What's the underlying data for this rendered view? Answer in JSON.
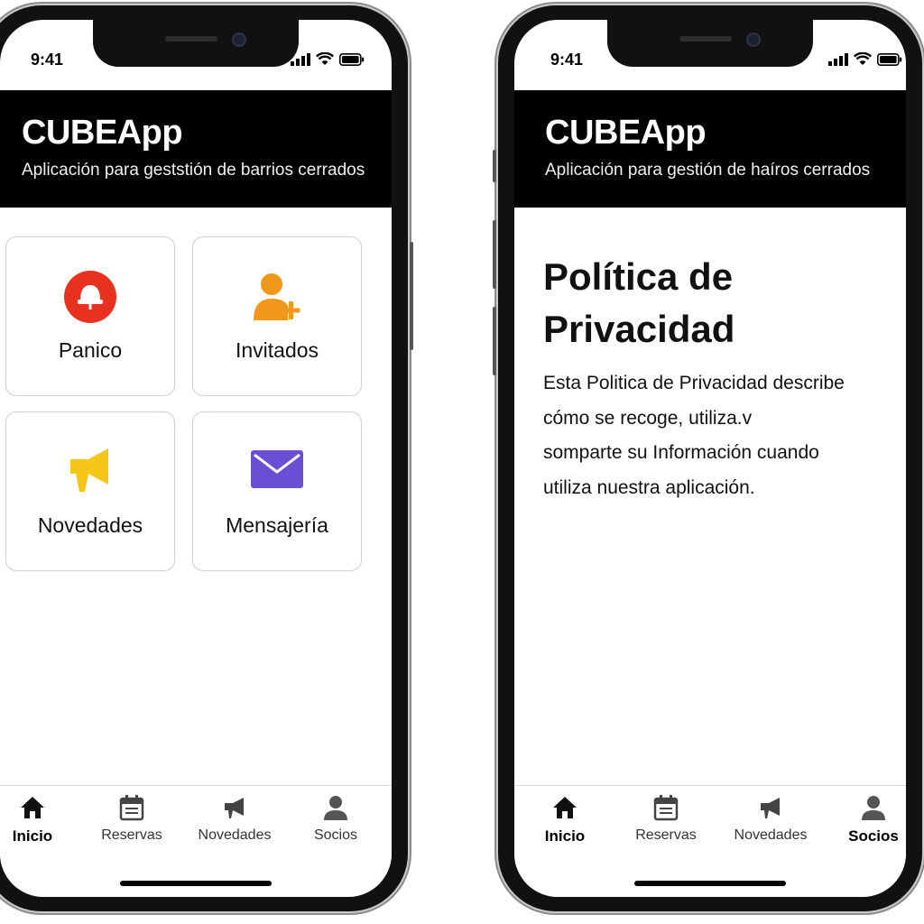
{
  "colors": {
    "header_bg": "#000000",
    "panic": "#e8311f",
    "guests": "#f0981a",
    "news": "#f5c518",
    "messages": "#6a4fd4",
    "tab_icon": "#444444"
  },
  "left_phone": {
    "status": {
      "time": "9:41"
    },
    "header": {
      "title": "CUBEApp",
      "subtitle": "Aplicación para geststión de barrios cerrados"
    },
    "cards": [
      {
        "label": "Panico",
        "icon": "panic-alarm-icon"
      },
      {
        "label": "Invitados",
        "icon": "add-guest-icon"
      },
      {
        "label": "Novedades",
        "icon": "megaphone-icon"
      },
      {
        "label": "Mensajería",
        "icon": "envelope-icon"
      }
    ],
    "tabbar": [
      {
        "label": "Inicio",
        "icon": "home-icon",
        "active": true
      },
      {
        "label": "Reservas",
        "icon": "calendar-icon",
        "active": false
      },
      {
        "label": "Novedades",
        "icon": "megaphone-icon",
        "active": false
      },
      {
        "label": "Socios",
        "icon": "person-icon",
        "active": false
      }
    ]
  },
  "right_phone": {
    "status": {
      "time": "9:41"
    },
    "header": {
      "title": "CUBEApp",
      "subtitle": "Aplicación para gestión de haíros cerrados"
    },
    "policy": {
      "title_line1": "Política de",
      "title_line2": "Privacidad",
      "body": "Esta Politica de Privacidad describe\ncómo se recoge, utiliza.v\nsomparte su Información  cuando\nutiliza nuestra aplicación."
    },
    "tabbar": [
      {
        "label": "Inicio",
        "icon": "home-icon",
        "active": true
      },
      {
        "label": "Reservas",
        "icon": "calendar-icon",
        "active": false
      },
      {
        "label": "Novedades",
        "icon": "megaphone-icon",
        "active": false
      },
      {
        "label": "Socios",
        "icon": "person-icon",
        "active": true
      }
    ]
  }
}
